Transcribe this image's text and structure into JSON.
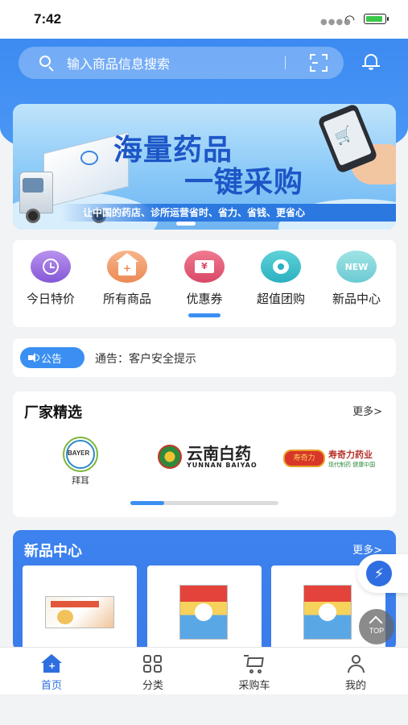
{
  "status_bar": {
    "time": "7:42"
  },
  "search": {
    "placeholder": "输入商品信息搜索"
  },
  "banner": {
    "title_line1": "海量药品",
    "title_line2": "一键采购",
    "slogan": "让中国的药店、诊所运营省时、省力、省钱、更省心"
  },
  "quick_nav": {
    "items": [
      {
        "label": "今日特价",
        "icon": "alarm-clock-icon",
        "color": "#8a5cd9"
      },
      {
        "label": "所有商品",
        "icon": "store-icon",
        "color": "#ec8a55"
      },
      {
        "label": "优惠券",
        "icon": "coupon-icon",
        "color": "#d94968",
        "icon_text": "¥"
      },
      {
        "label": "超值团购",
        "icon": "group-buy-icon",
        "color": "#2bb0c0"
      },
      {
        "label": "新品中心",
        "icon": "new-badge-icon",
        "color": "#6ccad3",
        "icon_text": "NEW"
      }
    ],
    "active_index": 2
  },
  "notice": {
    "badge_label": "公告",
    "text": "通告：客户安全提示"
  },
  "brands": {
    "title": "厂家精选",
    "more_label": "更多>",
    "items": [
      {
        "name": "拜耳",
        "logo_text": "BAYER"
      },
      {
        "name": "云南白药",
        "logo_text": "YUNNAN BAIYAO"
      },
      {
        "name": "寿奇力药业",
        "logo_text": "寿奇力",
        "tagline": "现代制药 健康中国"
      }
    ]
  },
  "new_products": {
    "title": "新品中心",
    "more_label": "更多>"
  },
  "floating": {
    "top_label": "TOP"
  },
  "tab_bar": {
    "items": [
      {
        "label": "首页",
        "icon": "home-icon",
        "active": true
      },
      {
        "label": "分类",
        "icon": "category-grid-icon",
        "active": false
      },
      {
        "label": "采购车",
        "icon": "cart-icon",
        "active": false
      },
      {
        "label": "我的",
        "icon": "user-icon",
        "active": false
      }
    ]
  },
  "colors": {
    "primary": "#3b8ff2",
    "tab_active": "#2f6ee0",
    "page_bg": "#f2f3f5"
  }
}
